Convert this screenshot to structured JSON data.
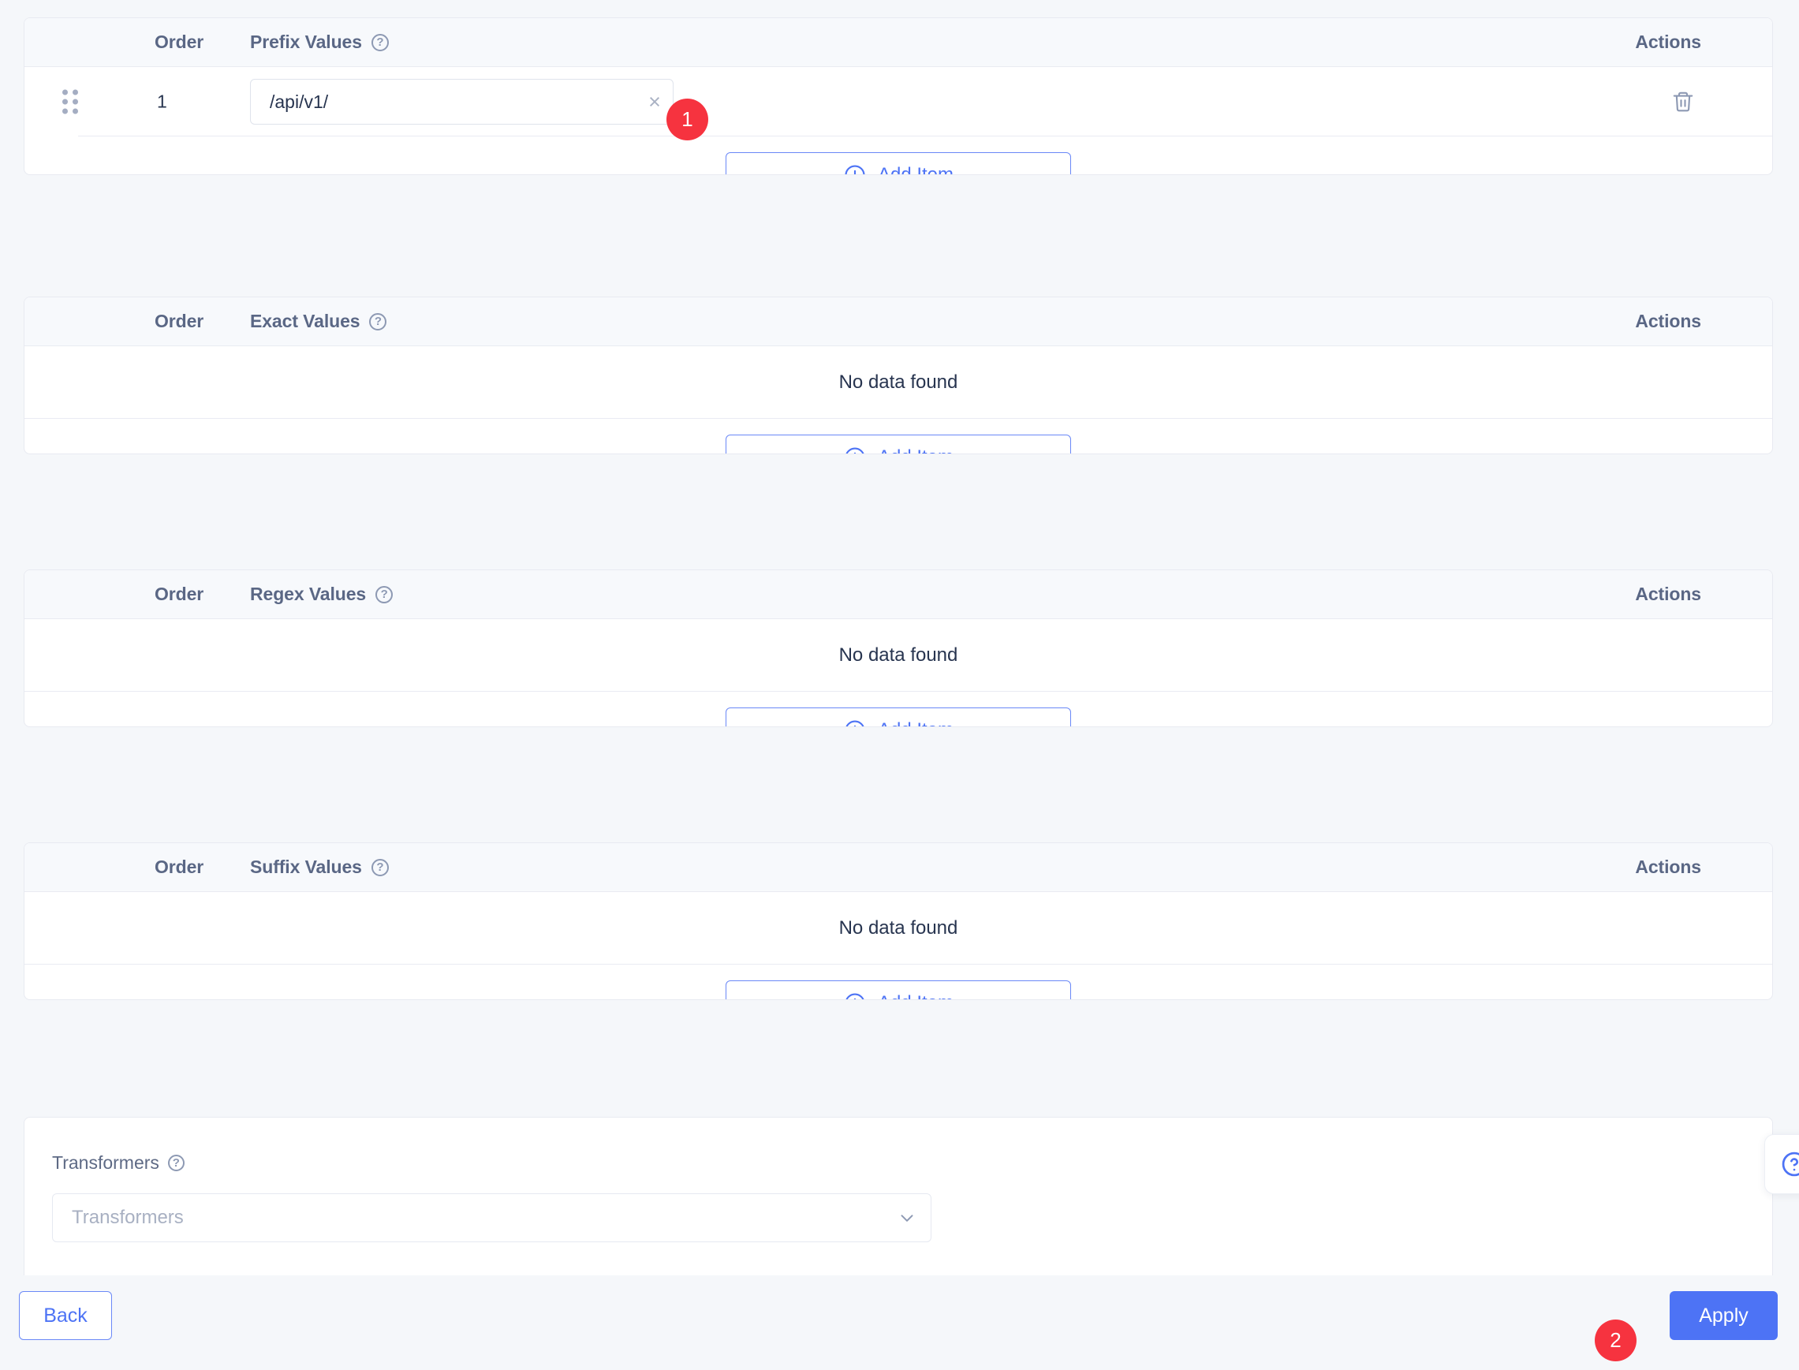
{
  "colors": {
    "accent": "#4d73f5",
    "badge_red": "#f6333f",
    "header_text": "#5a6785",
    "body_text": "#27344f",
    "page_bg": "#f5f7fa",
    "table_header_bg": "#f7f9fc",
    "border": "#e8eaf1"
  },
  "common": {
    "order_header": "Order",
    "actions_header": "Actions",
    "add_item_label": "Add Item",
    "no_data_label": "No data found",
    "help_glyph": "?",
    "plus_glyph": "+",
    "clear_glyph": "×"
  },
  "sections": [
    {
      "id": "prefix",
      "values_header": "Prefix Values",
      "rows": [
        {
          "order": "1",
          "value": "/api/v1/",
          "placeholder": ""
        }
      ],
      "empty_text": null,
      "add_item_label": "Add Item"
    },
    {
      "id": "exact",
      "values_header": "Exact Values",
      "rows": [],
      "empty_text": "No data found",
      "add_item_label": "Add Item"
    },
    {
      "id": "regex",
      "values_header": "Regex Values",
      "rows": [],
      "empty_text": "No data found",
      "add_item_label": "Add Item"
    },
    {
      "id": "suffix",
      "values_header": "Suffix Values",
      "rows": [],
      "empty_text": "No data found",
      "add_item_label": "Add Item"
    }
  ],
  "transformers": {
    "label": "Transformers",
    "placeholder": "Transformers",
    "value": ""
  },
  "footer": {
    "back_label": "Back",
    "apply_label": "Apply"
  },
  "annotations": [
    {
      "id": "badge-1",
      "text": "1"
    },
    {
      "id": "badge-2",
      "text": "2"
    }
  ],
  "help_widget": {
    "icon": "question-circle-icon"
  }
}
